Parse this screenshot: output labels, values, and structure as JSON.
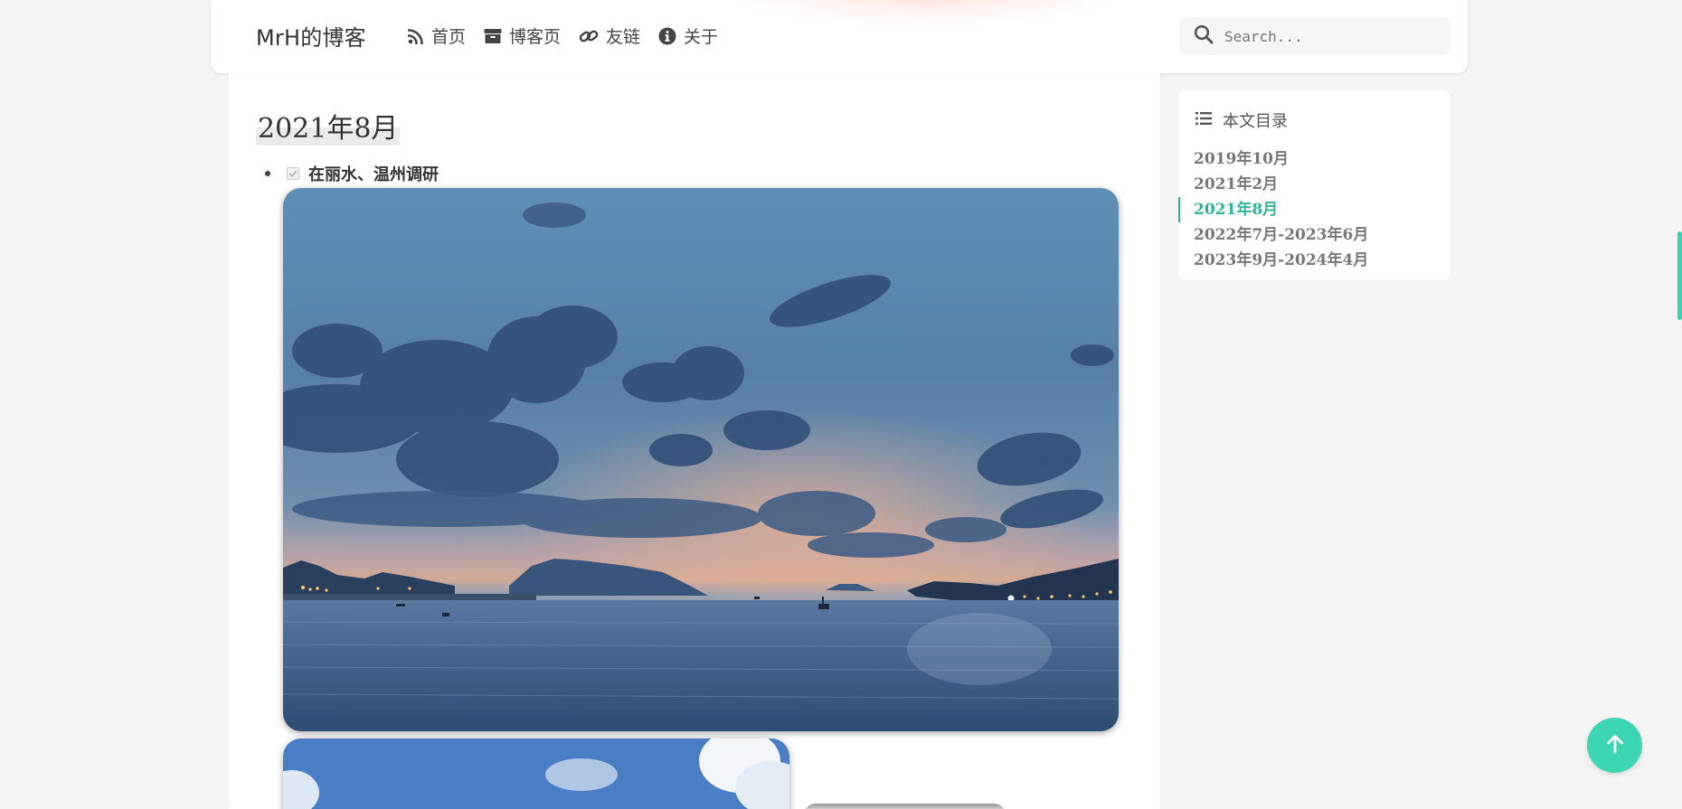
{
  "header": {
    "brand": "MrH的博客",
    "nav": [
      {
        "label": "首页",
        "icon": "rss-icon"
      },
      {
        "label": "博客页",
        "icon": "archive-icon"
      },
      {
        "label": "友链",
        "icon": "link-icon"
      },
      {
        "label": "关于",
        "icon": "info-icon"
      }
    ],
    "search": {
      "placeholder": "Search..."
    }
  },
  "main": {
    "section_title": "2021年8月",
    "task": {
      "label": "在丽水、温州调研",
      "checked": true
    }
  },
  "toc": {
    "title": "本文目录",
    "items": [
      {
        "label": "2019年10月",
        "active": false
      },
      {
        "label": "2021年2月",
        "active": false
      },
      {
        "label": "2021年8月",
        "active": true
      },
      {
        "label": "2022年7月-2023年6月",
        "active": false
      },
      {
        "label": "2023年9月-2024年4月",
        "active": false
      }
    ]
  },
  "colors": {
    "accent": "#3ed6b2",
    "toc_active": "#2bb596",
    "background": "#f4f4f4"
  }
}
